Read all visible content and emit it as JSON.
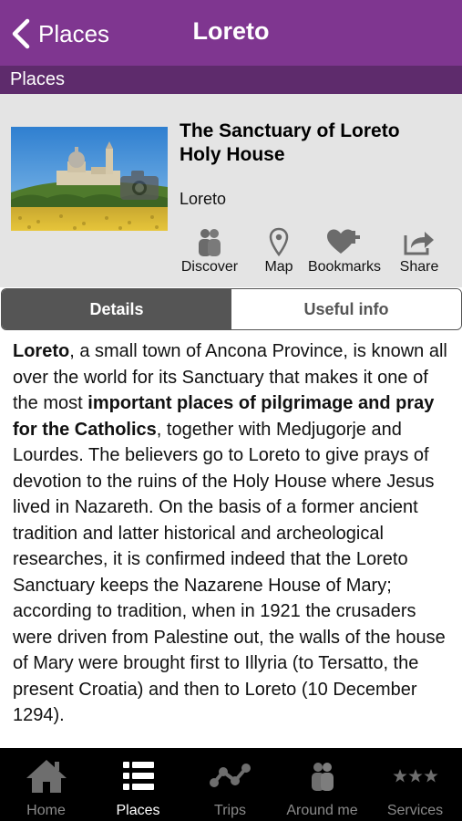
{
  "navbar": {
    "back_label": "Places",
    "title": "Loreto"
  },
  "section": {
    "label": "Places"
  },
  "place": {
    "title_line1": "The Sanctuary of Loreto",
    "title_line2": "Holy House",
    "city": "Loreto"
  },
  "actions": [
    {
      "label": "Discover",
      "icon": "people-icon"
    },
    {
      "label": "Map",
      "icon": "map-pin-icon"
    },
    {
      "label": "Bookmarks",
      "icon": "heart-plus-icon"
    },
    {
      "label": "Share",
      "icon": "share-icon"
    }
  ],
  "segments": {
    "details": "Details",
    "useful_info": "Useful info",
    "selected": "Details"
  },
  "description": {
    "p1_bold_start": "Loreto",
    "p1_text_a": ", a small town of Ancona Province, is known all over the world for its Sanctuary that makes it one of the most ",
    "p1_bold_mid": "important places of pilgrimage and pray for the Catholics",
    "p1_text_b": ", together with Medjugorje and Lourdes. The believers go to Loreto to give prays of devotion to the ruins of the Holy House where Jesus lived in Nazareth. On the basis of a former ancient tradition and latter historical and archeological researches, it is confirmed indeed that the Loreto Sanctuary keeps the Nazarene House of Mary; according to tradition, when in 1921 the crusaders were driven from Palestine out, the walls of the house of Mary were brought first to Illyria (to Tersatto, the present Croatia) and then to Loreto (10 December 1294)."
  },
  "tabs": [
    {
      "label": "Home",
      "icon": "home-icon"
    },
    {
      "label": "Places",
      "icon": "list-icon"
    },
    {
      "label": "Trips",
      "icon": "route-icon"
    },
    {
      "label": "Around me",
      "icon": "people-icon"
    },
    {
      "label": "Services",
      "icon": "stars-icon"
    }
  ],
  "colors": {
    "navbar": "#7f3690",
    "section_strip": "#5e2b6c",
    "header_bg": "#e4e4e4",
    "segment_active": "#555555",
    "tabbar": "#000000"
  }
}
